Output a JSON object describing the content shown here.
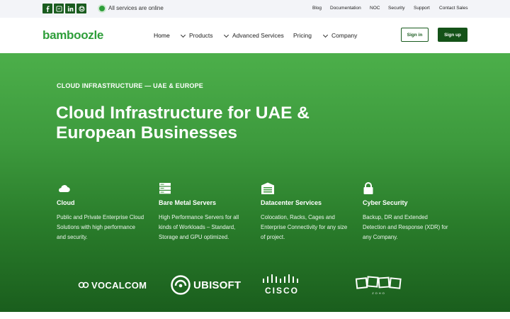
{
  "topbar": {
    "social": [
      {
        "name": "facebook-icon"
      },
      {
        "name": "twitter-icon"
      },
      {
        "name": "linkedin-icon"
      },
      {
        "name": "github-icon"
      }
    ],
    "status_text": "All services are online",
    "links": [
      "Blog",
      "Documentation",
      "NOC",
      "Security",
      "Support",
      "Contact Sales"
    ]
  },
  "header": {
    "logo": "bamboozle",
    "nav": {
      "home": "Home",
      "products": "Products",
      "advanced": "Advanced Services",
      "pricing": "Pricing",
      "company": "Company"
    },
    "signin": "Sign in",
    "signup": "Sign up"
  },
  "hero": {
    "eyebrow": "CLOUD INFRASTRUCTURE — UAE & EUROPE",
    "title": "Cloud Infrastructure for UAE & European Businesses",
    "features": [
      {
        "icon": "cloud-icon",
        "title": "Cloud",
        "desc": "Public and Private Enterprise Cloud Solutions with high performance and security."
      },
      {
        "icon": "server-icon",
        "title": "Bare Metal Servers",
        "desc": "High Performance Servers for all kinds of Workloads – Standard, Storage and GPU optimized."
      },
      {
        "icon": "datacenter-icon",
        "title": "Datacenter Services",
        "desc": "Colocation, Racks, Cages and Enterprise Connectivity for any size of project."
      },
      {
        "icon": "lock-icon",
        "title": "Cyber Security",
        "desc": "Backup, DR and Extended Detection and Response (XDR) for any Company."
      }
    ],
    "client_logos": {
      "vocalcom": "VOCALCOM",
      "ubisoft": "UBISOFT",
      "cisco": "CISCO",
      "zoho": "ZOHO"
    }
  },
  "colors": {
    "brand_green": "#2e9e3a",
    "dark_green": "#145218",
    "status_green": "#2e9e3a"
  }
}
